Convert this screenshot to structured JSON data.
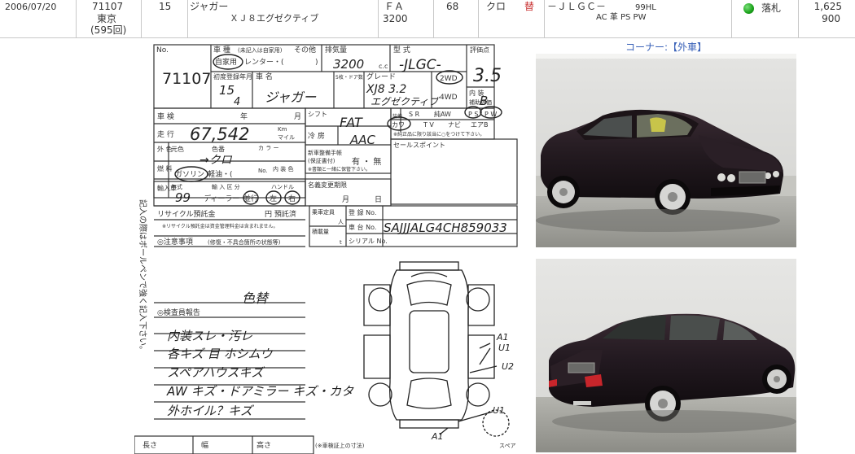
{
  "listing": {
    "date": "2006/07/20",
    "lot_no": "71107",
    "venue": "東京",
    "session": "(595回)",
    "year": "15",
    "maker": "ジャガー",
    "model_grade": "ＸＪ８エグゼクティブ",
    "shift": "ＦＡ",
    "displacement": "3200",
    "km": "68",
    "color": "クロ",
    "color_change": "替",
    "type_code": "－ＪＬＧＣ－",
    "code_tag": "99HL",
    "equipment": "AC 革 PS PW",
    "status": "落札",
    "price_1": "1,625",
    "price_2": "900",
    "status_color": "#1aa21a"
  },
  "corner": {
    "label": "コーナー:",
    "value": "【外車】"
  },
  "sheet": {
    "printed": {
      "no": "No.",
      "category": "車 種",
      "category_note": "(未記入は自家用)",
      "other": "その他",
      "private": "自家用",
      "rental": "レンター・(",
      "rental_close": ")",
      "displacement": "排気量",
      "cc": "c.c",
      "model_type": "型 式",
      "grade_score": "評価点",
      "reg_date": "初度登録年月",
      "car_name": "車 名",
      "doors": "5枚・ドア数",
      "grade": "グレード",
      "wd2": "2WD",
      "wd4": "4WD",
      "interior": "内 装",
      "interior_sub": "補助評価",
      "shaken": "車 検",
      "year": "年",
      "month": "月",
      "shift": "シフト",
      "mileage": "走 行",
      "km_unit": "Km",
      "mile_unit": "マイル",
      "aircon": "冷 房",
      "outer_color": "外 色",
      "orig_color": "元色",
      "color_no": "色番",
      "color_label": "カ ラ ー",
      "no_label": "No.",
      "fuel": "燃 料",
      "gasoline": "ガソリン",
      "diesel": "軽油・(",
      "int_color": "内 装 色",
      "spare_manual": "新車整備手帳",
      "warranty": "(保証書付)",
      "yes_no": "有 ・ 無",
      "manual_note": "※書類と一緒に保管下さい。",
      "import": "輸入車",
      "model_year": "年式",
      "import_type": "輸 入 区 分",
      "handle": "ハンドル",
      "dealer": "ディーラー・",
      "parallel": "並行",
      "left": "左",
      "right": "右",
      "recycle": "リサイクル預託金",
      "yen": "円 預託済",
      "recycle_note": "※リサイクル預託金は資金管理料金は含まれません。",
      "name_change_deadline": "名義変更期限",
      "month2": "月",
      "day": "日",
      "capacity": "乗車定員",
      "persons": "人",
      "reg_no": "登 録 No.",
      "chassis": "車 台 No.",
      "loading": "積載量",
      "ton": "t",
      "serial": "シリアル No.",
      "caution": "◎注意事項",
      "caution_note": "(修復・不具合箇所の状態等)",
      "inspector": "◎検査員報告",
      "sales_point": "セールスポイント",
      "equip_sr": "S R",
      "equip_leather": "純AW",
      "equip_ps": "P S",
      "equip_pw": "P W",
      "equip_cas": "カワ",
      "equip_tv": "T V",
      "equip_navi": "ナビ",
      "equip_ab": "エアB",
      "equip_label": "装備",
      "equip_note": "※純正品に限り該当に○をつけて下さい。",
      "size_length": "長さ",
      "size_width": "幅",
      "size_height": "高さ",
      "size_note": "(※車検証上の寸法)",
      "vertical_note": "記入の際はボールペンで強く記入下さい。",
      "spare": "スペア"
    },
    "handwritten": {
      "lot_no": "71107",
      "displacement": "3200",
      "model_type": "-JLGC-",
      "score": "3.5",
      "interior_grade": "B",
      "year": "15",
      "month": "4",
      "car_name": "ジャガー",
      "model": "XJ8 3.2",
      "grade": "エグゼクティブ",
      "shift": "FAT",
      "aircon": "AAC",
      "mileage": "67,542",
      "color": "→クロ",
      "model_year": "99",
      "chassis": "SAJJJALG4CH859033",
      "color_note": "色替",
      "report_1": "内装スレ・汚レ",
      "report_2": "各キズ 目 ホシムウ",
      "report_3": "スペアハウスキズ",
      "report_4": "AW キズ・ドアミラー キズ・カタ",
      "report_5": "外ホイル？キズ",
      "mark_a1": "A1",
      "mark_u1": "U1",
      "mark_u2": "U2",
      "mark_u1b": "U1",
      "mark_a1b": "A1"
    }
  }
}
